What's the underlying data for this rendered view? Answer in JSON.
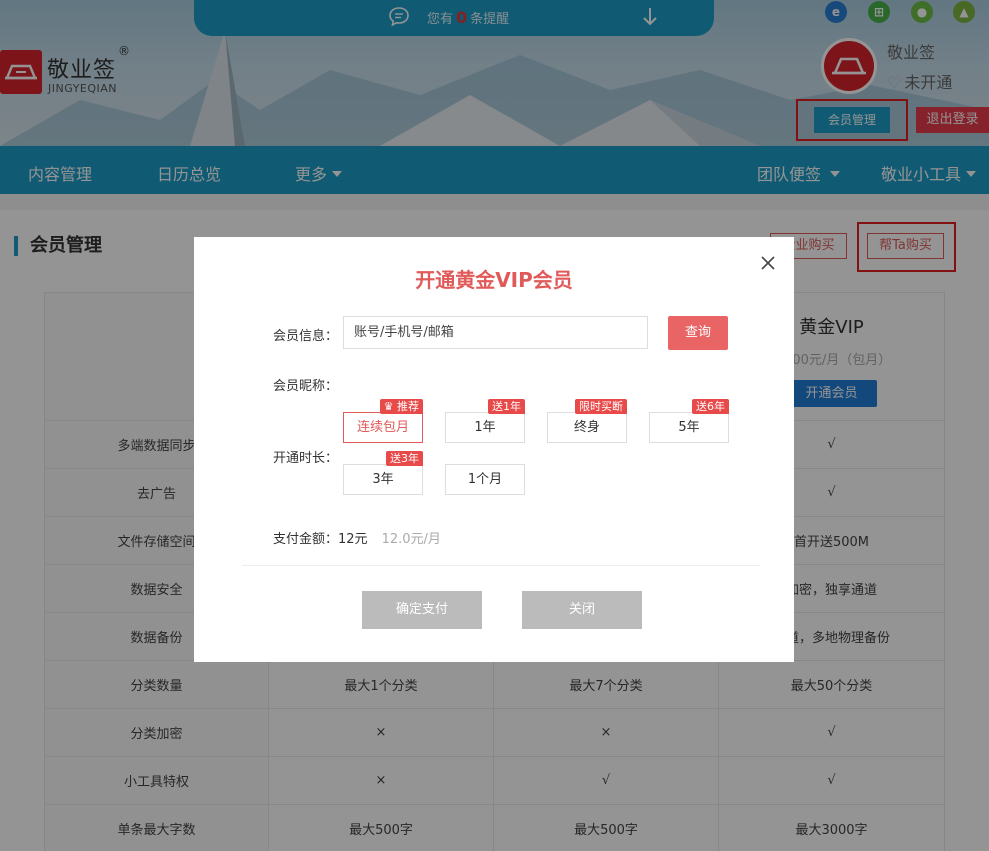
{
  "notice": {
    "prefix": "您有",
    "count": "0",
    "suffix": "条提醒"
  },
  "logo": {
    "name": "敬业签",
    "registered": "®",
    "subtitle": "JINGYEQIAN"
  },
  "platforms": [
    {
      "name": "ie-icon",
      "glyph": "e",
      "color": "#2a7fd4"
    },
    {
      "name": "windows-icon",
      "glyph": "▞",
      "color": "#49b24a"
    },
    {
      "name": "apple-icon",
      "glyph": "●",
      "color": "#6cbd45"
    },
    {
      "name": "android-icon",
      "glyph": "▲",
      "color": "#7cb342"
    }
  ],
  "user": {
    "name": "敬业签",
    "status": "未开通",
    "member_btn": "会员管理",
    "logout_btn": "退出登录"
  },
  "nav": {
    "left": [
      "内容管理",
      "日历总览",
      "更多"
    ],
    "right": [
      "团队便签",
      "敬业小工具"
    ]
  },
  "page": {
    "title": "会员管理",
    "btn_enterprise": "企业购买",
    "btn_help": "帮Ta购买"
  },
  "table": {
    "vip": {
      "title": "黄金VIP",
      "price": "10.00元/月（包月）",
      "open_btn": "开通会员"
    },
    "rows": [
      {
        "label": "多端数据同步",
        "c1": "",
        "c2": "",
        "c3": "√"
      },
      {
        "label": "去广告",
        "c1": "",
        "c2": "",
        "c3": "√"
      },
      {
        "label": "文件存储空间",
        "c1": "",
        "c2": "",
        "c3": "首开送500M"
      },
      {
        "label": "数据安全",
        "c1": "",
        "c2": "",
        "c3": "加密，独享通道"
      },
      {
        "label": "数据备份",
        "c1": "",
        "c2": "",
        "c3": "通道，多地物理备份"
      },
      {
        "label": "分类数量",
        "c1": "最大1个分类",
        "c2": "最大7个分类",
        "c3": "最大50个分类"
      },
      {
        "label": "分类加密",
        "c1": "×",
        "c2": "×",
        "c3": "√"
      },
      {
        "label": "小工具特权",
        "c1": "×",
        "c2": "√",
        "c3": "√"
      },
      {
        "label": "单条最大字数",
        "c1": "最大500字",
        "c2": "最大500字",
        "c3": "最大3000字"
      }
    ]
  },
  "modal": {
    "title": "开通黄金VIP会员",
    "label_info": "会员信息：",
    "input_placeholder": "账号/手机号/邮箱",
    "query_btn": "查询",
    "label_nickname": "会员昵称：",
    "label_duration": "开通时长：",
    "options": [
      {
        "label": "连续包月",
        "badge": "推荐",
        "selected": true
      },
      {
        "label": "1年",
        "badge": "送1年",
        "selected": false
      },
      {
        "label": "终身",
        "badge": "限时买断",
        "selected": false
      },
      {
        "label": "5年",
        "badge": "送6年",
        "selected": false
      },
      {
        "label": "3年",
        "badge": "送3年",
        "selected": false
      },
      {
        "label": "1个月",
        "badge": "",
        "selected": false
      }
    ],
    "amount_label": "支付金额：",
    "amount_value": "12元",
    "amount_per": "12.0元/月",
    "confirm_btn": "确定支付",
    "close_btn": "关闭"
  }
}
